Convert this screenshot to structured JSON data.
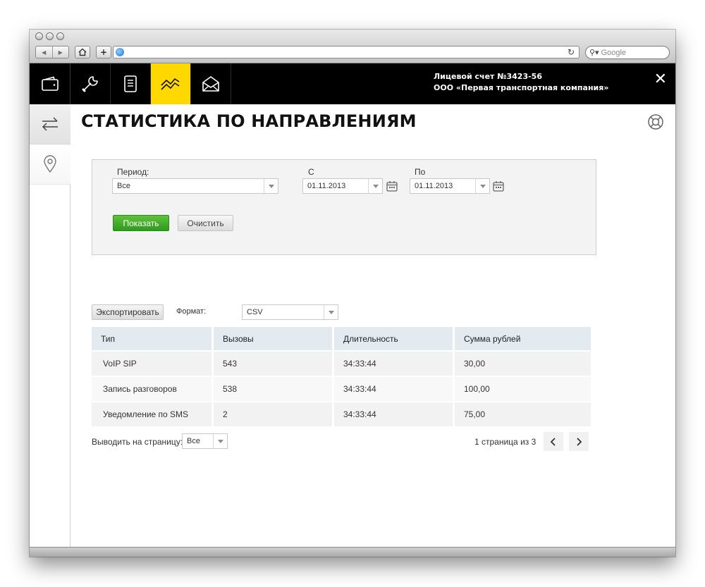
{
  "browser": {
    "search_placeholder": "Google"
  },
  "topbar": {
    "tabs": [
      {
        "icon": "wallet-icon"
      },
      {
        "icon": "wrench-icon"
      },
      {
        "icon": "notebook-icon"
      },
      {
        "icon": "chart-line-icon",
        "active": true
      },
      {
        "icon": "envelope-icon"
      }
    ],
    "account_line1": "Лицевой счет №3423-56",
    "account_line2": "ООО «Первая транспортная компания»",
    "close_label": "✕"
  },
  "rail": {
    "items": [
      {
        "icon": "directions-arrows-icon",
        "active": true
      },
      {
        "icon": "location-pin-icon",
        "active": false
      }
    ]
  },
  "page": {
    "title": "СТАТИСТИКА ПО НАПРАВЛЕНИЯМ",
    "help_icon": "lifebuoy-icon"
  },
  "filter": {
    "period_label": "Период:",
    "period_value": "Все",
    "from_label": "С",
    "from_value": "01.11.2013",
    "to_label": "По",
    "to_value": "01.11.2013",
    "show_button": "Показать",
    "clear_button": "Очистить"
  },
  "export": {
    "button": "Экспортировать",
    "format_label": "Формат:",
    "format_value": "CSV"
  },
  "table": {
    "columns": [
      "Тип",
      "Вызовы",
      "Длительность",
      "Сумма рублей"
    ],
    "rows": [
      [
        "VoIP SIP",
        "543",
        "34:33:44",
        "30,00"
      ],
      [
        "Запись разговоров",
        "538",
        "34:33:44",
        "100,00"
      ],
      [
        "Уведомление по SMS",
        "2",
        "34:33:44",
        "75,00"
      ]
    ]
  },
  "pagination": {
    "per_page_label": "Выводить на страницу:",
    "per_page_value": "Все",
    "page_info": "1 страница из 3",
    "prev_icon": "chevron-left-icon",
    "next_icon": "chevron-right-icon"
  },
  "colors": {
    "accent_yellow": "#ffd800",
    "show_green": "#3fa826",
    "header_blue": "#e3ebf0",
    "topbar_black": "#000000"
  }
}
